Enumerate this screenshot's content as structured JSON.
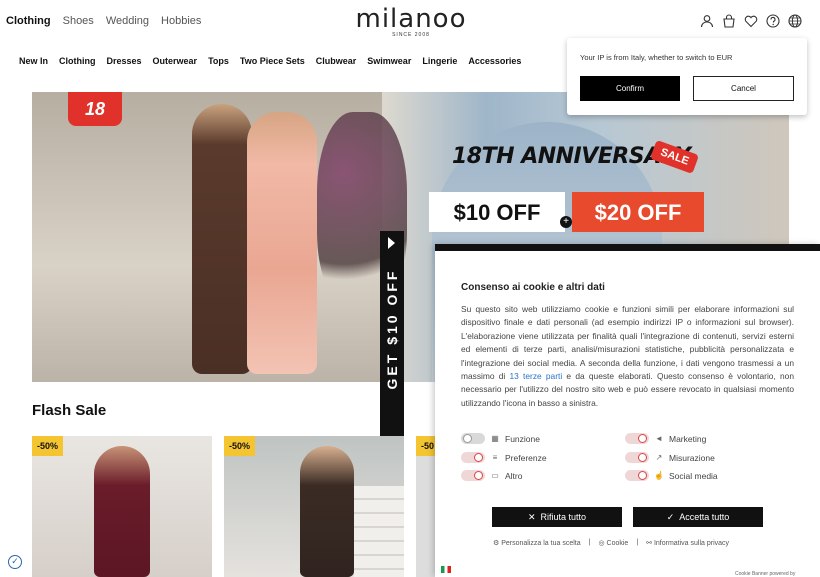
{
  "top_nav": [
    "Clothing",
    "Shoes",
    "Wedding",
    "Hobbies"
  ],
  "logo": {
    "name": "milanoo",
    "since": "SINCE 2008"
  },
  "header_icons": [
    "user-icon",
    "bag-icon",
    "heart-icon",
    "help-icon",
    "globe-icon"
  ],
  "categories": [
    "New In",
    "Clothing",
    "Dresses",
    "Outerwear",
    "Tops",
    "Two Piece Sets",
    "Clubwear",
    "Swimwear",
    "Lingerie",
    "Accessories"
  ],
  "hero": {
    "badge": "18",
    "headline": "18TH ANNIVERSARY",
    "sale_tag": "SALE",
    "offer1": "$10 OFF",
    "offer2": "$20 OFF"
  },
  "side_tab": "GET $10 OFF",
  "flash_sale": {
    "title": "Flash Sale",
    "cards": [
      {
        "discount": "-50%"
      },
      {
        "discount": "-50%"
      },
      {
        "discount": "-50"
      }
    ]
  },
  "ip_prompt": {
    "message": "Your IP is from Italy, whether to switch to EUR",
    "confirm": "Confirm",
    "cancel": "Cancel"
  },
  "cookie_banner": {
    "title": "Consenso ai cookie e altri dati",
    "body_before_link": "Su questo sito web utilizziamo cookie e funzioni simili per elaborare informazioni sul dispositivo finale e dati personali (ad esempio indirizzi IP o informazioni sul browser). L'elaborazione viene utilizzata per finalità quali l'integrazione di contenuti, servizi esterni ed elementi di terze parti, analisi/misurazioni statistiche, pubblicità personalizzata e l'integrazione dei social media. A seconda della funzione, i dati vengono trasmessi a un massimo di ",
    "link_text": "13 terze parti",
    "body_after_link": " e da queste elaborati. Questo consenso è volontario, non necessario per l'utilizzo del nostro sito web e può essere revocato in qualsiasi momento utilizzando l'icona in basso a sinistra.",
    "toggles": [
      {
        "label": "Funzione",
        "on": true
      },
      {
        "label": "Marketing",
        "on": false
      },
      {
        "label": "Preferenze",
        "on": false
      },
      {
        "label": "Misurazione",
        "on": false
      },
      {
        "label": "Altro",
        "on": false
      },
      {
        "label": "Social media",
        "on": false
      }
    ],
    "reject_label": "Rifiuta tutto",
    "accept_label": "Accetta tutto",
    "links": [
      "Personalizza la tua scelta",
      "Cookie",
      "Informativa sulla privacy"
    ],
    "powered_by": "Cookie Banner powered by"
  }
}
